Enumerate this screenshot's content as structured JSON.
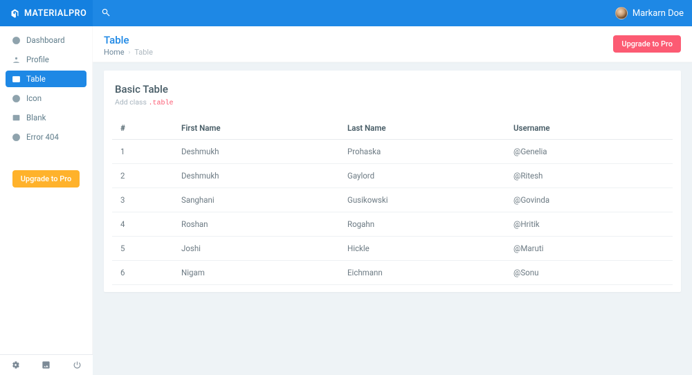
{
  "brand": {
    "name": "MATERIALPRO"
  },
  "user": {
    "name": "Markarn Doe"
  },
  "sidebar": {
    "items": [
      {
        "label": "Dashboard",
        "icon": "dashboard",
        "active": false
      },
      {
        "label": "Profile",
        "icon": "profile",
        "active": false
      },
      {
        "label": "Table",
        "icon": "table",
        "active": true
      },
      {
        "label": "Icon",
        "icon": "smile",
        "active": false
      },
      {
        "label": "Blank",
        "icon": "blank",
        "active": false
      },
      {
        "label": "Error 404",
        "icon": "help",
        "active": false
      }
    ],
    "upgrade_label": "Upgrade to Pro"
  },
  "page": {
    "title": "Table",
    "breadcrumb": {
      "home": "Home",
      "current": "Table"
    },
    "upgrade_label": "Upgrade to Pro"
  },
  "card": {
    "title": "Basic Table",
    "sub_prefix": "Add class ",
    "sub_code": ".table"
  },
  "table": {
    "headers": {
      "id": "#",
      "first_name": "First Name",
      "last_name": "Last Name",
      "username": "Username"
    },
    "rows": [
      {
        "id": "1",
        "first_name": "Deshmukh",
        "last_name": "Prohaska",
        "username": "@Genelia"
      },
      {
        "id": "2",
        "first_name": "Deshmukh",
        "last_name": "Gaylord",
        "username": "@Ritesh"
      },
      {
        "id": "3",
        "first_name": "Sanghani",
        "last_name": "Gusikowski",
        "username": "@Govinda"
      },
      {
        "id": "4",
        "first_name": "Roshan",
        "last_name": "Rogahn",
        "username": "@Hritik"
      },
      {
        "id": "5",
        "first_name": "Joshi",
        "last_name": "Hickle",
        "username": "@Maruti"
      },
      {
        "id": "6",
        "first_name": "Nigam",
        "last_name": "Eichmann",
        "username": "@Sonu"
      }
    ]
  }
}
